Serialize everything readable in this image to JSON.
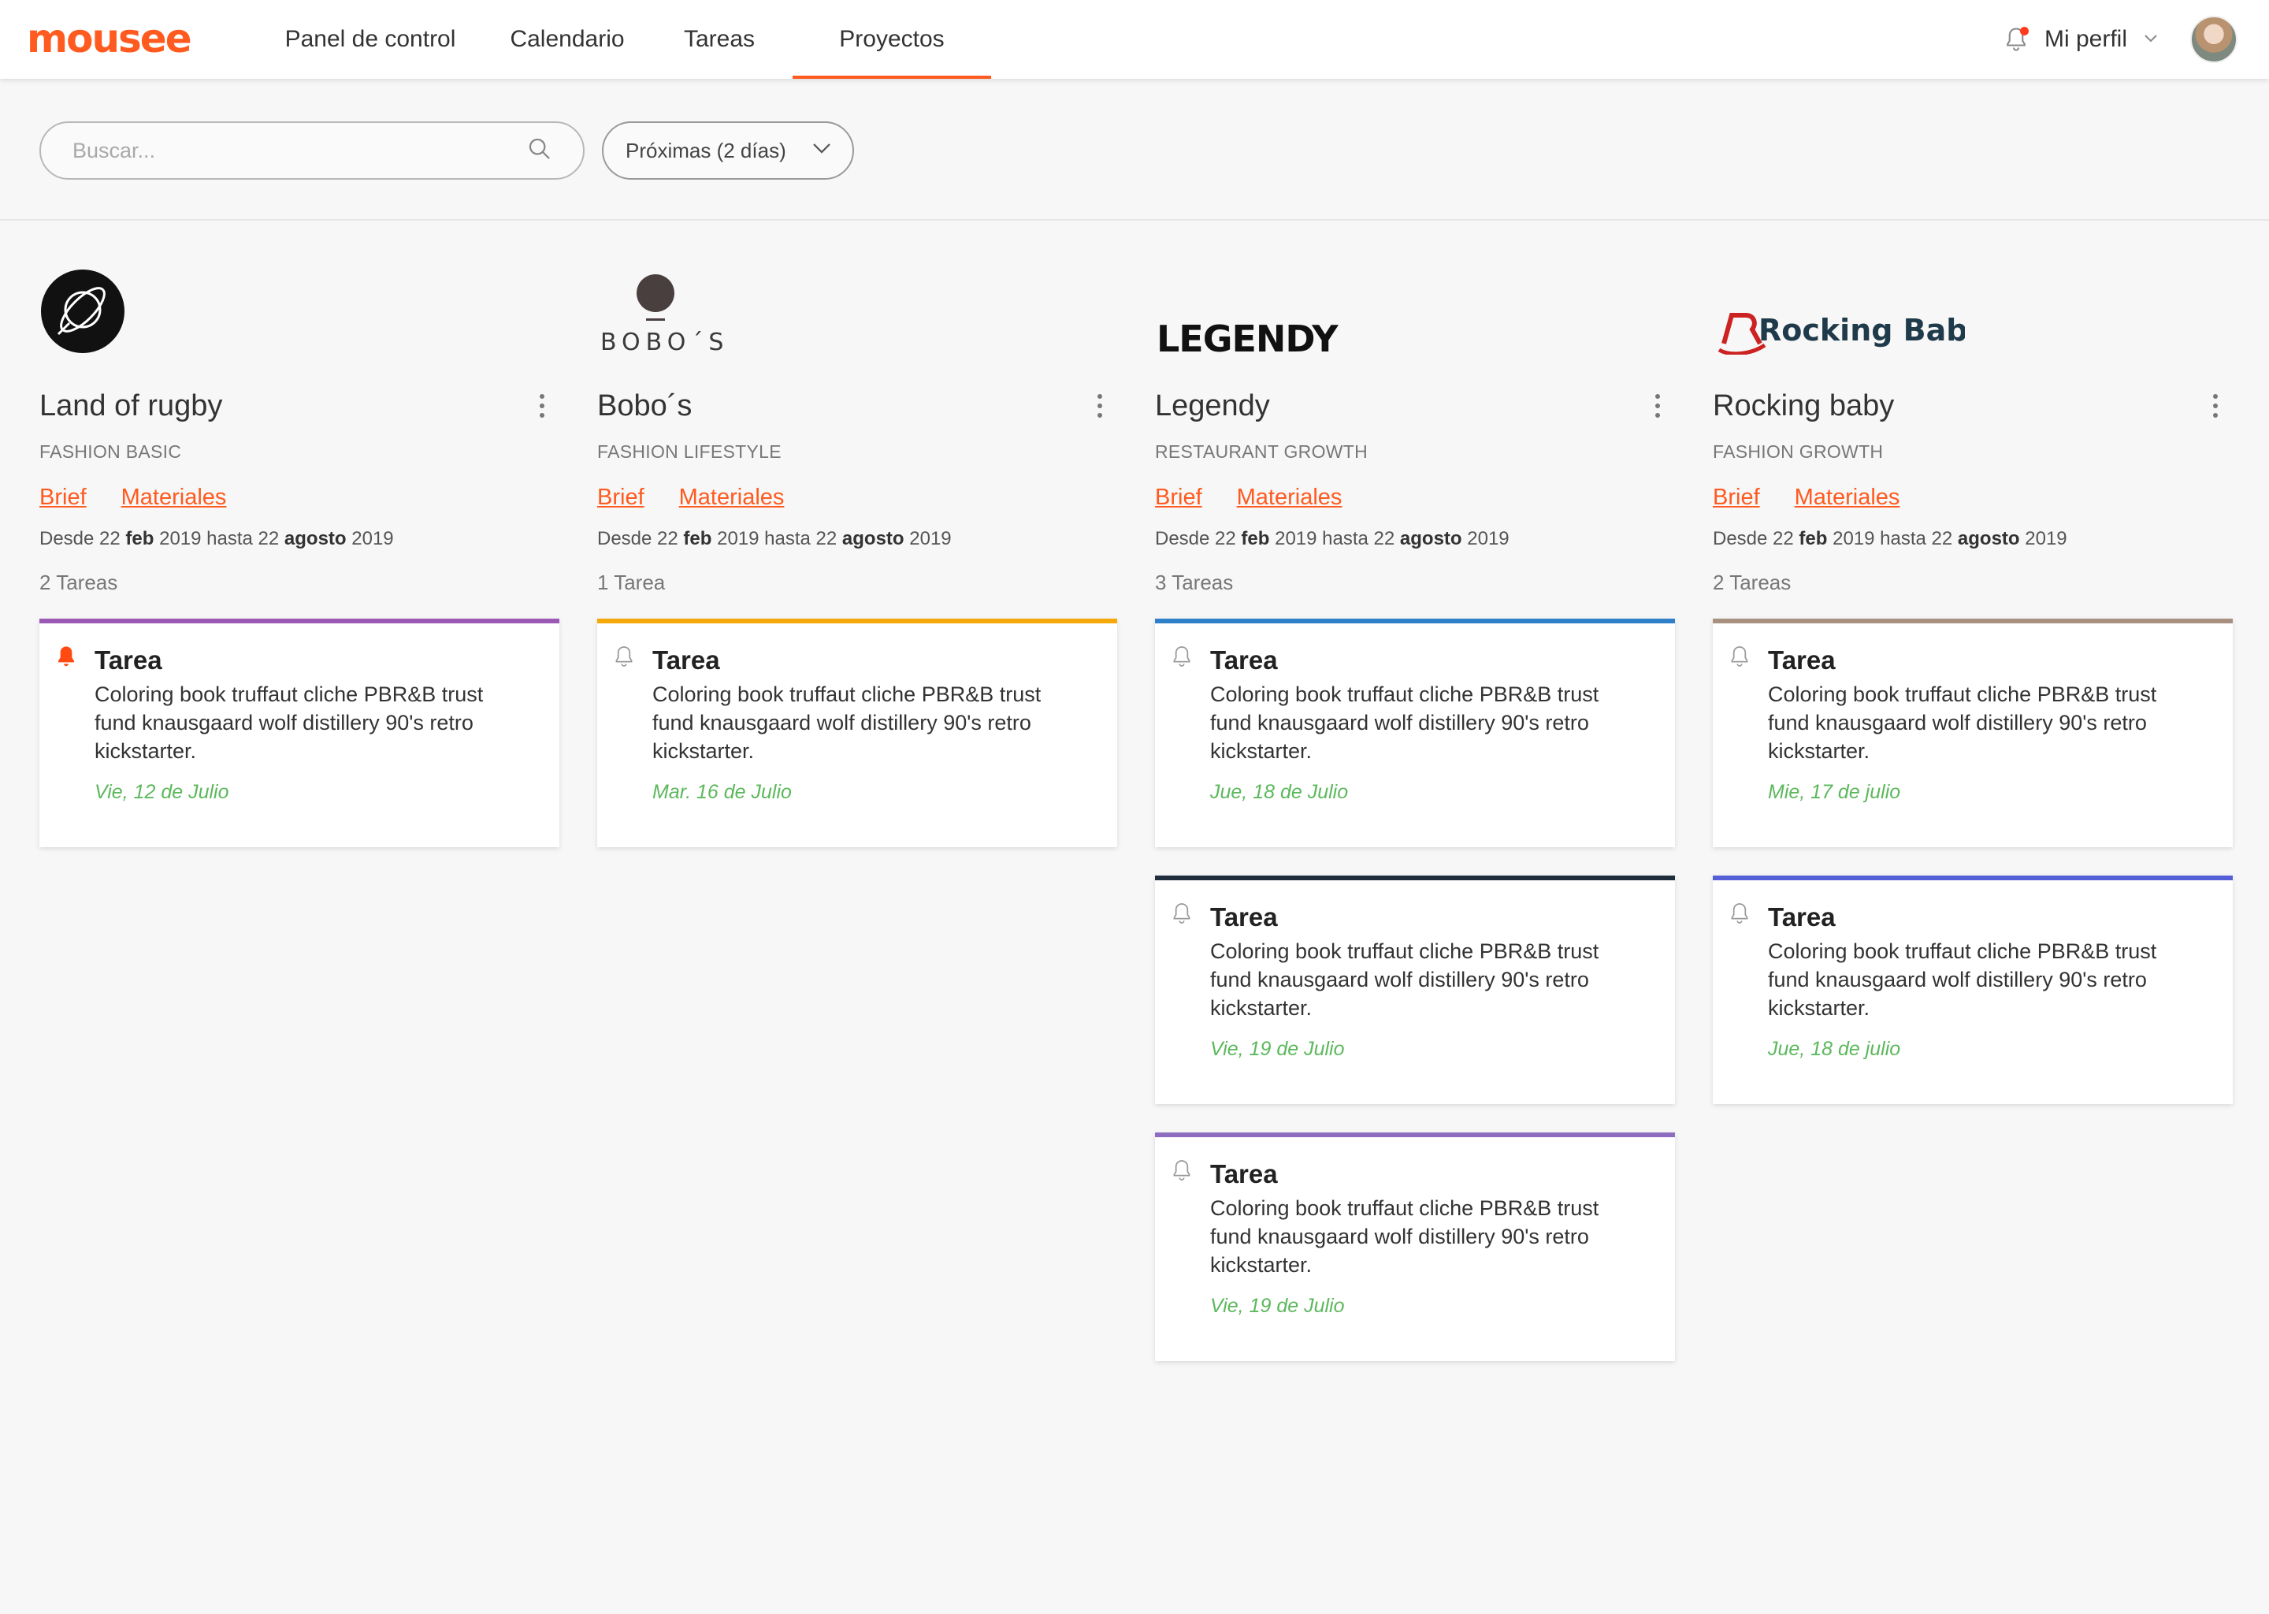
{
  "header": {
    "logo": "mousee",
    "nav": [
      {
        "label": "Panel de control"
      },
      {
        "label": "Calendario"
      },
      {
        "label": "Tareas"
      },
      {
        "label": "Proyectos"
      }
    ],
    "active_nav": "Proyectos",
    "profile_label": "Mi perfil"
  },
  "filters": {
    "search_placeholder": "Buscar...",
    "dropdown_value": "Próximas (2 días)"
  },
  "colors": {
    "accent": "#ff5a1f",
    "date_green": "#5cb85c"
  },
  "projects": [
    {
      "name": "Land of rugby",
      "category": "FASHION BASIC",
      "brief_label": "Brief",
      "materials_label": "Materiales",
      "dates": {
        "desde": "Desde 22",
        "m1": "feb",
        "y1": "2019 hasta 22",
        "m2": "agosto",
        "y2": "2019"
      },
      "count": "2 Tareas",
      "tasks": [
        {
          "title": "Tarea",
          "desc": "Coloring book truffaut cliche PBR&B trust fund knausgaard wolf distillery 90's retro kickstarter.",
          "date": "Vie, 12 de Julio",
          "color": "#9b59b6",
          "alert": true
        }
      ]
    },
    {
      "name": "Bobo´s",
      "logo_text": "BOBO´S",
      "category": "FASHION LIFESTYLE",
      "brief_label": "Brief",
      "materials_label": "Materiales",
      "dates": {
        "desde": "Desde 22",
        "m1": "feb",
        "y1": "2019 hasta 22",
        "m2": "agosto",
        "y2": "2019"
      },
      "count": "1 Tarea",
      "tasks": [
        {
          "title": "Tarea",
          "desc": "Coloring book truffaut cliche PBR&B trust fund knausgaard wolf distillery 90's retro kickstarter.",
          "date": "Mar. 16 de Julio",
          "color": "#f5a80a",
          "alert": false
        }
      ]
    },
    {
      "name": "Legendy",
      "logo_text": "LEGENDY",
      "category": "RESTAURANT GROWTH",
      "brief_label": "Brief",
      "materials_label": "Materiales",
      "dates": {
        "desde": "Desde 22",
        "m1": "feb",
        "y1": "2019 hasta 22",
        "m2": "agosto",
        "y2": "2019"
      },
      "count": "3 Tareas",
      "tasks": [
        {
          "title": "Tarea",
          "desc": "Coloring book truffaut cliche PBR&B trust fund knausgaard wolf distillery 90's retro kickstarter.",
          "date": "Jue, 18 de Julio",
          "color": "#2f80c9",
          "alert": false
        },
        {
          "title": "Tarea",
          "desc": "Coloring book truffaut cliche PBR&B trust fund knausgaard wolf distillery 90's retro kickstarter.",
          "date": "Vie, 19 de Julio",
          "color": "#1f2d3d",
          "alert": false
        },
        {
          "title": "Tarea",
          "desc": "Coloring book truffaut cliche PBR&B trust fund knausgaard wolf distillery 90's retro kickstarter.",
          "date": "Vie, 19 de Julio",
          "color": "#8e6cc0",
          "alert": false
        }
      ]
    },
    {
      "name": "Rocking baby",
      "logo_text": "Rocking Baby",
      "category": "FASHION GROWTH",
      "brief_label": "Brief",
      "materials_label": "Materiales",
      "dates": {
        "desde": "Desde 22",
        "m1": "feb",
        "y1": "2019 hasta 22",
        "m2": "agosto",
        "y2": "2019"
      },
      "count": "2 Tareas",
      "tasks": [
        {
          "title": "Tarea",
          "desc": "Coloring book truffaut cliche PBR&B trust fund knausgaard wolf distillery 90's retro kickstarter.",
          "date": "Mie, 17 de julio",
          "color": "#a89080",
          "alert": false
        },
        {
          "title": "Tarea",
          "desc": "Coloring book truffaut cliche PBR&B trust fund knausgaard wolf distillery 90's retro kickstarter.",
          "date": "Jue, 18 de julio",
          "color": "#5560d8",
          "alert": false
        }
      ]
    }
  ]
}
